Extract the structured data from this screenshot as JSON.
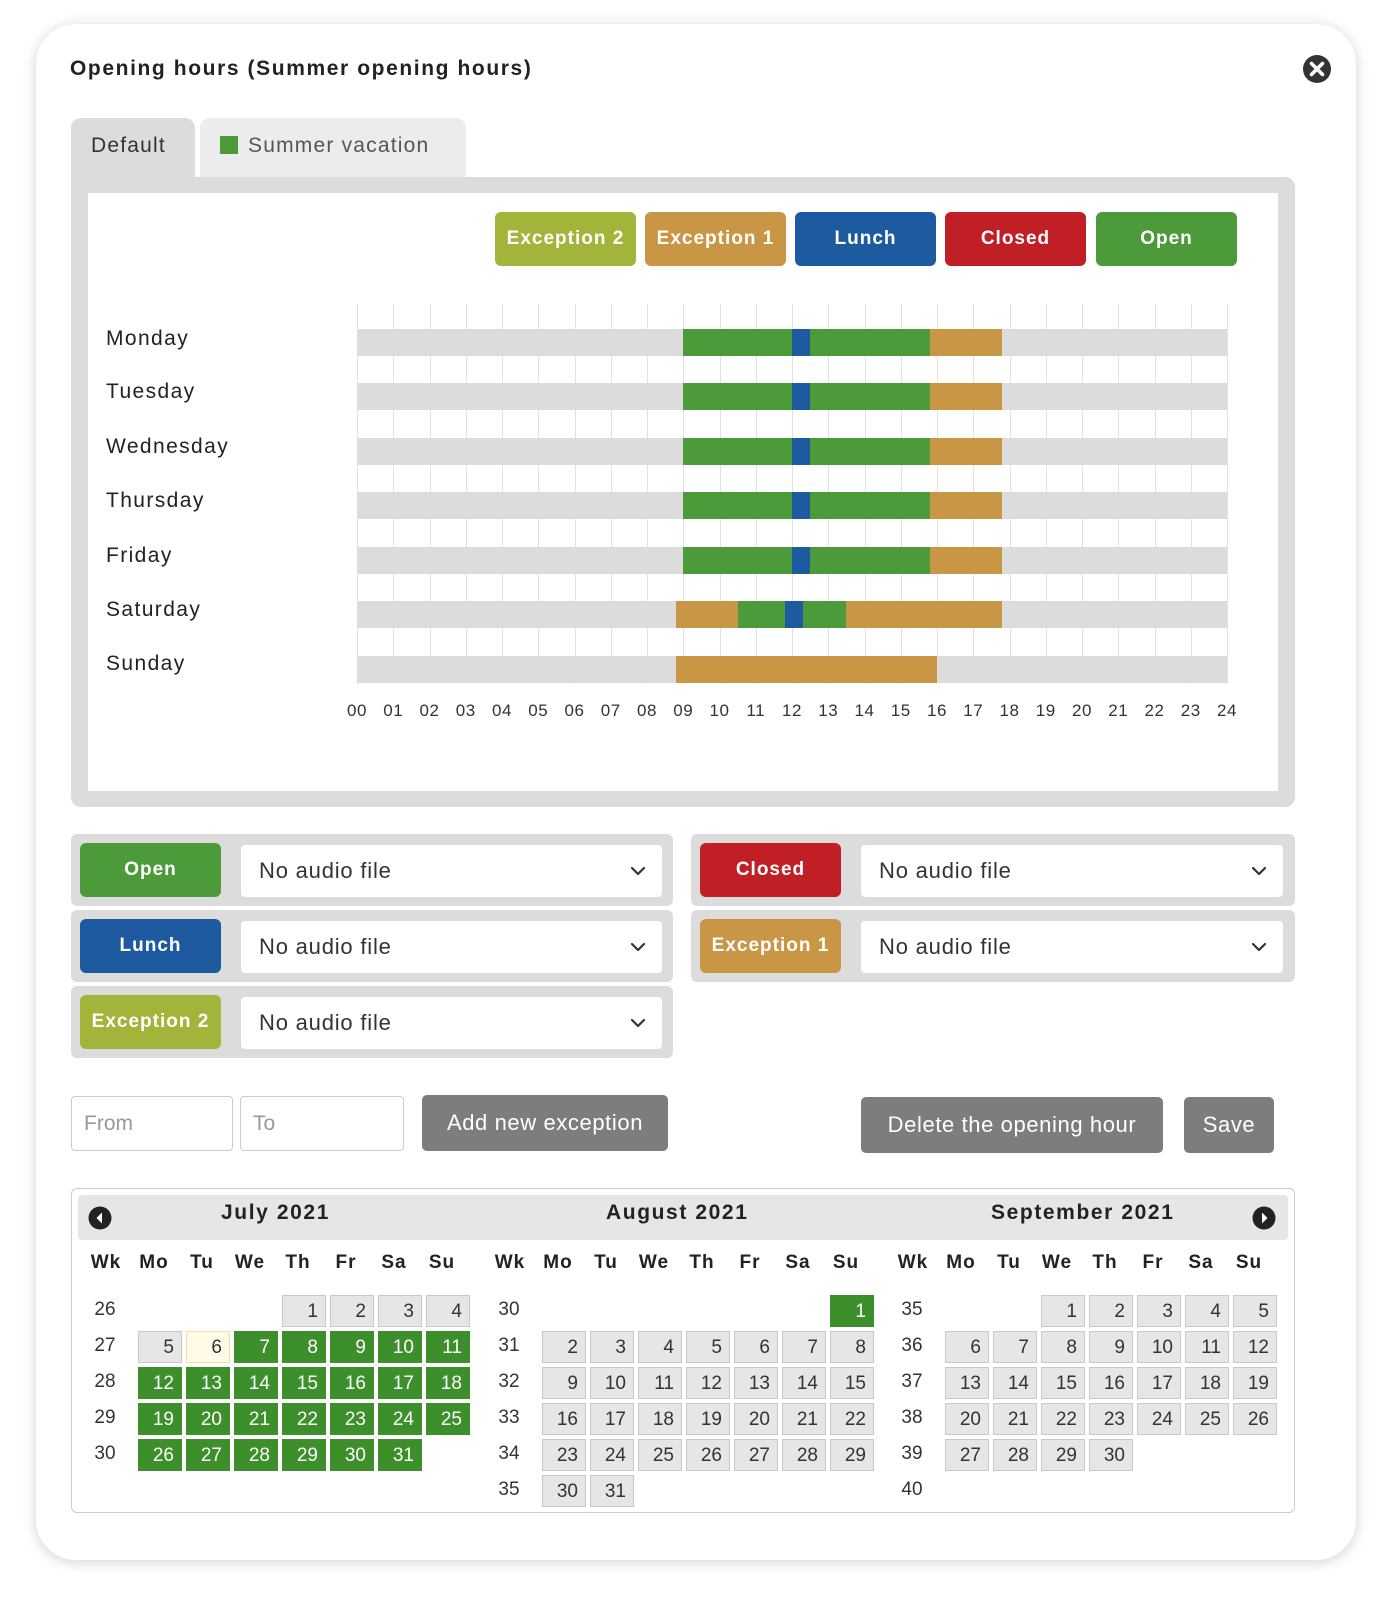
{
  "dialog": {
    "title": "Opening hours (Summer opening hours)",
    "close_icon": "close-circle-icon"
  },
  "tabs": [
    {
      "label": "Default",
      "active": true
    },
    {
      "label": "Summer vacation",
      "swatch_color": "#4c9a3a",
      "active": false
    }
  ],
  "legend": [
    {
      "label": "Exception 2",
      "color": "#a3b43a"
    },
    {
      "label": "Exception 1",
      "color": "#c99645"
    },
    {
      "label": "Lunch",
      "color": "#1d5aa0"
    },
    {
      "label": "Closed",
      "color": "#c01f25"
    },
    {
      "label": "Open",
      "color": "#4c9a3a"
    }
  ],
  "schedule": {
    "hours": [
      "00",
      "01",
      "02",
      "03",
      "04",
      "05",
      "06",
      "07",
      "08",
      "09",
      "10",
      "11",
      "12",
      "13",
      "14",
      "15",
      "16",
      "17",
      "18",
      "19",
      "20",
      "21",
      "22",
      "23",
      "24"
    ],
    "days": [
      {
        "name": "Monday",
        "segments": [
          {
            "type": "open",
            "start": 9,
            "end": 12
          },
          {
            "type": "lunch",
            "start": 12,
            "end": 12.5
          },
          {
            "type": "open",
            "start": 12.5,
            "end": 15.8
          },
          {
            "type": "exception1",
            "start": 15.8,
            "end": 17.8
          }
        ]
      },
      {
        "name": "Tuesday",
        "segments": [
          {
            "type": "open",
            "start": 9,
            "end": 12
          },
          {
            "type": "lunch",
            "start": 12,
            "end": 12.5
          },
          {
            "type": "open",
            "start": 12.5,
            "end": 15.8
          },
          {
            "type": "exception1",
            "start": 15.8,
            "end": 17.8
          }
        ]
      },
      {
        "name": "Wednesday",
        "segments": [
          {
            "type": "open",
            "start": 9,
            "end": 12
          },
          {
            "type": "lunch",
            "start": 12,
            "end": 12.5
          },
          {
            "type": "open",
            "start": 12.5,
            "end": 15.8
          },
          {
            "type": "exception1",
            "start": 15.8,
            "end": 17.8
          }
        ]
      },
      {
        "name": "Thursday",
        "segments": [
          {
            "type": "open",
            "start": 9,
            "end": 12
          },
          {
            "type": "lunch",
            "start": 12,
            "end": 12.5
          },
          {
            "type": "open",
            "start": 12.5,
            "end": 15.8
          },
          {
            "type": "exception1",
            "start": 15.8,
            "end": 17.8
          }
        ]
      },
      {
        "name": "Friday",
        "segments": [
          {
            "type": "open",
            "start": 9,
            "end": 12
          },
          {
            "type": "lunch",
            "start": 12,
            "end": 12.5
          },
          {
            "type": "open",
            "start": 12.5,
            "end": 15.8
          },
          {
            "type": "exception1",
            "start": 15.8,
            "end": 17.8
          }
        ]
      },
      {
        "name": "Saturday",
        "segments": [
          {
            "type": "exception1",
            "start": 8.8,
            "end": 10.5
          },
          {
            "type": "open",
            "start": 10.5,
            "end": 11.8
          },
          {
            "type": "lunch",
            "start": 11.8,
            "end": 12.3
          },
          {
            "type": "open",
            "start": 12.3,
            "end": 13.5
          },
          {
            "type": "exception1",
            "start": 13.5,
            "end": 17.8
          }
        ]
      },
      {
        "name": "Sunday",
        "segments": [
          {
            "type": "exception1",
            "start": 8.8,
            "end": 16
          }
        ]
      }
    ]
  },
  "audio": [
    {
      "label": "Open",
      "color": "#4c9a3a",
      "value": "No audio file"
    },
    {
      "label": "Closed",
      "color": "#c01f25",
      "value": "No audio file"
    },
    {
      "label": "Lunch",
      "color": "#1d5aa0",
      "value": "No audio file"
    },
    {
      "label": "Exception 1",
      "color": "#c99645",
      "value": "No audio file"
    },
    {
      "label": "Exception 2",
      "color": "#a3b43a",
      "value": "No audio file"
    }
  ],
  "exception_form": {
    "from_placeholder": "From",
    "to_placeholder": "To",
    "add_label": "Add new exception",
    "delete_label": "Delete the opening hour",
    "save_label": "Save"
  },
  "calendar": {
    "prev_icon": "chevron-left-circle-icon",
    "next_icon": "chevron-right-circle-icon",
    "dow": [
      "Wk",
      "Mo",
      "Tu",
      "We",
      "Th",
      "Fr",
      "Sa",
      "Su"
    ],
    "months": [
      {
        "title": "July 2021",
        "first_weekday": 3,
        "days": 31,
        "weeks": [
          "26",
          "27",
          "28",
          "29",
          "30"
        ],
        "selected_from": 7,
        "selected_to": 31,
        "today": 6
      },
      {
        "title": "August 2021",
        "first_weekday": 6,
        "days": 31,
        "weeks": [
          "30",
          "31",
          "32",
          "33",
          "34",
          "35"
        ],
        "selected_from": 1,
        "selected_to": 1,
        "today": null
      },
      {
        "title": "September 2021",
        "first_weekday": 2,
        "days": 30,
        "weeks": [
          "35",
          "36",
          "37",
          "38",
          "39",
          "40"
        ],
        "selected_from": null,
        "selected_to": null,
        "today": null
      }
    ]
  }
}
